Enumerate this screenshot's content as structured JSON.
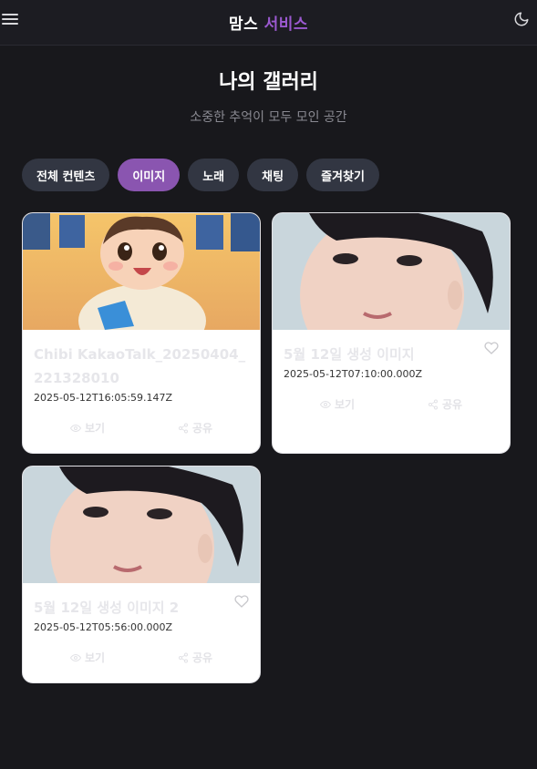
{
  "header": {
    "logo_main": "맘스",
    "logo_accent": "서비스",
    "accent_color": "#9b59d0"
  },
  "page": {
    "title": "나의 갤러리",
    "subtitle": "소중한 추억이 모두 모인 공간"
  },
  "tabs": [
    {
      "label": "전체 컨텐츠",
      "active": false
    },
    {
      "label": "이미지",
      "active": true
    },
    {
      "label": "노래",
      "active": false
    },
    {
      "label": "채팅",
      "active": false
    },
    {
      "label": "즐겨찾기",
      "active": false
    }
  ],
  "cards": [
    {
      "title": "Chibi KakaoTalk_20250404_221328010",
      "date": "2025-05-12T16:05:59.147Z",
      "thumb": "chibi-baby-illustration",
      "view_label": "보기",
      "share_label": "공유"
    },
    {
      "title": "5월 12일 생성 이미지",
      "date": "2025-05-12T07:10:00.000Z",
      "thumb": "woman-portrait",
      "view_label": "보기",
      "share_label": "공유"
    },
    {
      "title": "5월 12일 생성 이미지 2",
      "date": "2025-05-12T05:56:00.000Z",
      "thumb": "woman-portrait",
      "view_label": "보기",
      "share_label": "공유"
    }
  ]
}
